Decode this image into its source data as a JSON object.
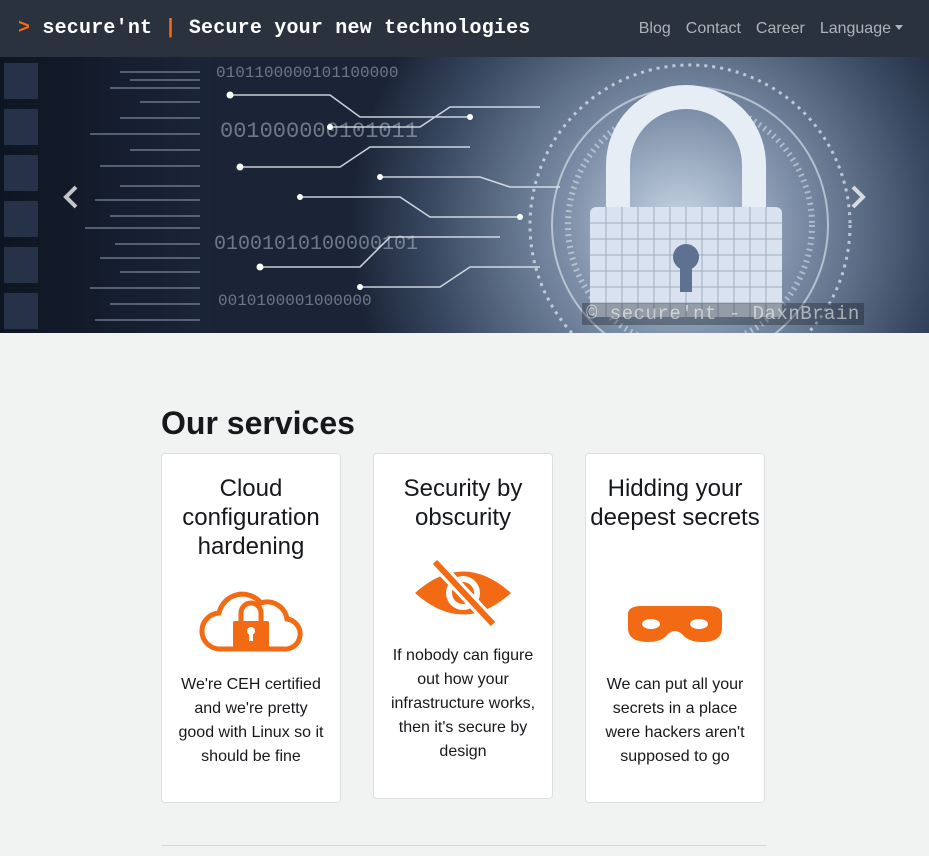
{
  "navbar": {
    "brand_prompt": ">",
    "brand_name": "secure'nt",
    "brand_separator": "|",
    "brand_tagline": "Secure your new technologies",
    "links": [
      "Blog",
      "Contact",
      "Career",
      "Language"
    ]
  },
  "carousel": {
    "watermark": "© secure'nt - DaxnBrain",
    "binary": [
      "0101100000101100000",
      "001000000101011",
      "01001010100000101",
      "0010100001000000"
    ]
  },
  "services": {
    "heading": "Our services",
    "cards": [
      {
        "title": "Cloud configuration hardening",
        "icon": "cloud-lock-icon",
        "text": "We're CEH certified and we're pretty good with Linux so it should be fine"
      },
      {
        "title": "Security by obscurity",
        "icon": "eye-slash-icon",
        "text": "If nobody can figure out how your infrastructure works, then it's secure by design"
      },
      {
        "title": "Hidding your deepest secrets",
        "icon": "mask-icon",
        "text": "We can put all your secrets in a place were hackers aren't supposed to go"
      }
    ]
  },
  "colors": {
    "accent": "#f26b14",
    "navbar": "#2a323d",
    "background": "#f1f2f2"
  }
}
